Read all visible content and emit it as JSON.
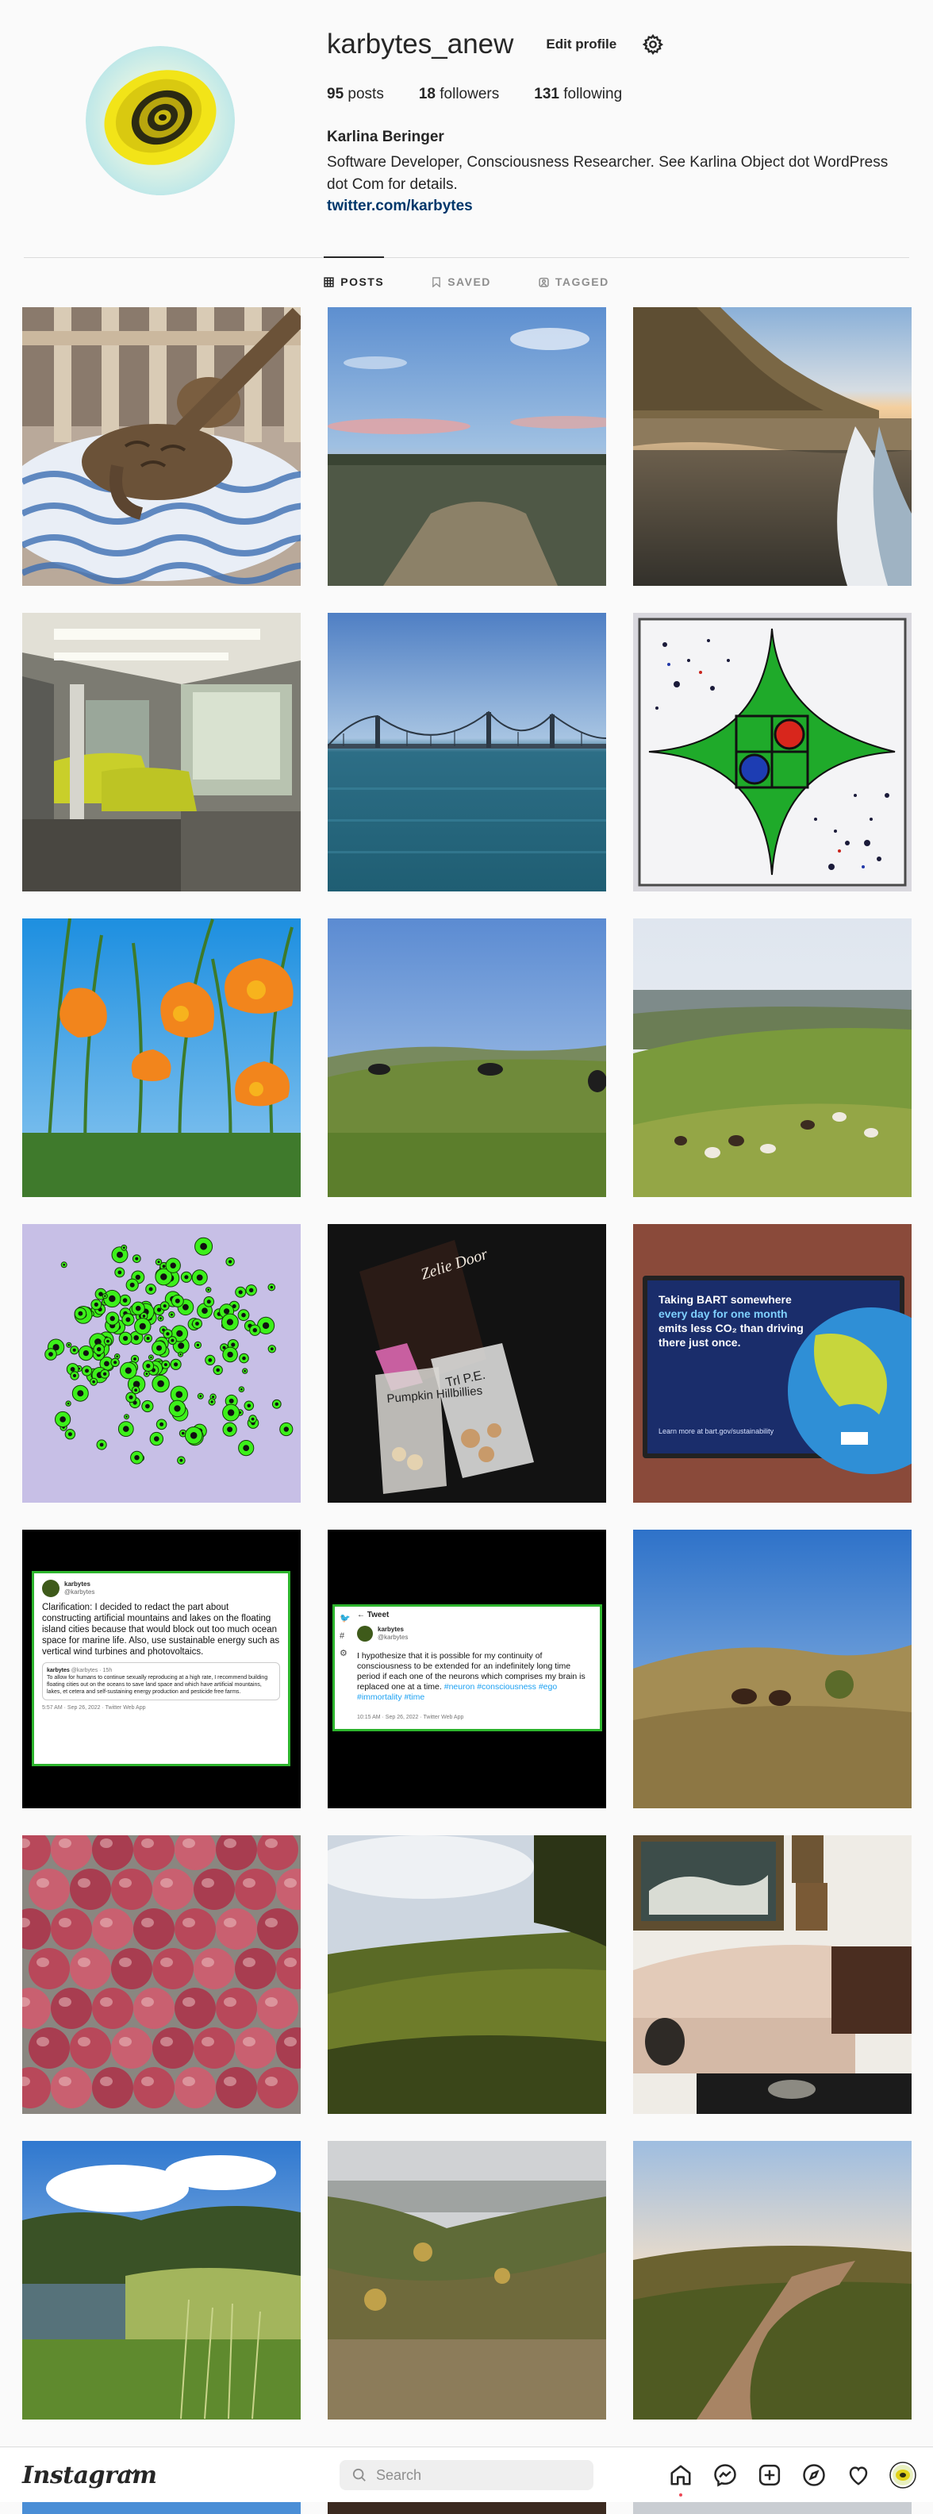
{
  "profile": {
    "username": "karbytes_anew",
    "edit_label": "Edit profile",
    "posts_count": "95",
    "posts_label": "posts",
    "followers_count": "18",
    "followers_label": "followers",
    "following_count": "131",
    "following_label": "following",
    "full_name": "Karlina Beringer",
    "bio": "Software Developer, Consciousness Researcher. See Karlina Object dot WordPress dot Com for details.",
    "link": "twitter.com/karbytes"
  },
  "tabs": [
    {
      "label": "POSTS",
      "icon": "grid-icon",
      "active": true
    },
    {
      "label": "SAVED",
      "icon": "bookmark-icon",
      "active": false
    },
    {
      "label": "TAGGED",
      "icon": "tag-icon",
      "active": false
    }
  ],
  "posts": [
    {
      "subject": "cat-on-cushion"
    },
    {
      "subject": "sunset-field"
    },
    {
      "subject": "beach-cliff"
    },
    {
      "subject": "bart-train-interior"
    },
    {
      "subject": "bay-bridge"
    },
    {
      "subject": "geometric-drawing"
    },
    {
      "subject": "orange-poppies"
    },
    {
      "subject": "cows-hillside"
    },
    {
      "subject": "sheep-hillside"
    },
    {
      "subject": "green-dots-art"
    },
    {
      "subject": "snack-bags",
      "caption1": "Pumpkin Hillbillies",
      "caption2": "Trl P.E.",
      "caption3": "Zelie Door"
    },
    {
      "subject": "bart-poster",
      "line1": "Taking BART somewhere",
      "line2": "every day for one month",
      "line3": "emits less CO₂ than driving",
      "line4": "there just once.",
      "footer": "Learn more at bart.gov/sustainability"
    },
    {
      "subject": "tweet-clarification",
      "name": "karbytes",
      "handle": "@karbytes",
      "text": "Clarification: I decided to redact the part about constructing artificial mountains and lakes on the floating island cities because that would block out too much ocean space for marine life. Also, use sustainable energy such as vertical wind turbines and photovoltaics.",
      "quoted_name": "karbytes",
      "quoted_handle": "@karbytes · 15h",
      "quoted_text": "To allow for humans to continue sexually reproducing at a high rate, I recommend building floating cities out on the oceans to save land space and which have artificial mountains, lakes, et cetera and self-sustaining energy production and pesticide free farms.",
      "meta": "5:57 AM · Sep 26, 2022 · Twitter Web App"
    },
    {
      "subject": "tweet-hypothesis",
      "header": "Tweet",
      "name": "karbytes",
      "handle": "@karbytes",
      "text": "I hypothesize that it is possible for my continuity of consciousness to be extended for an indefinitely long time period if each one of the neurons which comprises my brain is replaced one at a time.",
      "tags": "#neuron #consciousness #ego #immortality #time",
      "meta": "10:15 AM · Sep 26, 2022 · Twitter Web App"
    },
    {
      "subject": "cows-dry-field"
    },
    {
      "subject": "apples"
    },
    {
      "subject": "green-valley"
    },
    {
      "subject": "living-room-cat"
    },
    {
      "subject": "marsh-pond"
    },
    {
      "subject": "canyon-view"
    },
    {
      "subject": "dirt-trail"
    }
  ],
  "bottom_bar": {
    "logo": "Instagram",
    "search_placeholder": "Search",
    "nav": [
      "home-icon",
      "messenger-icon",
      "new-post-icon",
      "explore-icon",
      "activity-icon",
      "profile-avatar"
    ]
  }
}
